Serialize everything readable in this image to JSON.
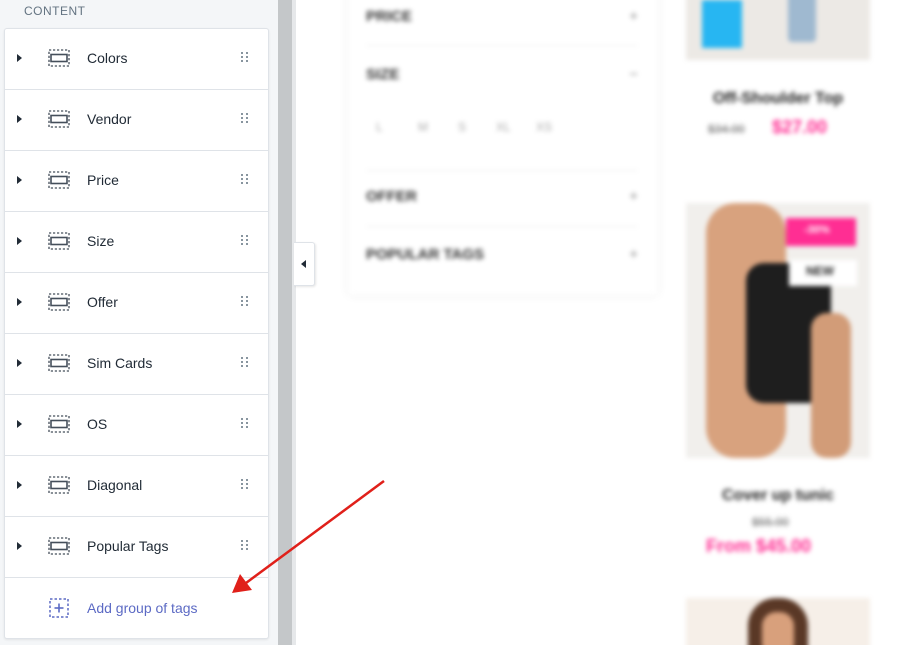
{
  "sidebar": {
    "section_title": "CONTENT",
    "items": [
      {
        "label": "Colors"
      },
      {
        "label": "Vendor"
      },
      {
        "label": "Price"
      },
      {
        "label": "Size"
      },
      {
        "label": "Offer"
      },
      {
        "label": "Sim Cards"
      },
      {
        "label": "OS"
      },
      {
        "label": "Diagonal"
      },
      {
        "label": "Popular Tags"
      }
    ],
    "add_label": "Add group of tags"
  },
  "preview": {
    "filters": [
      {
        "label": "PRICE",
        "sign": "+"
      },
      {
        "label": "SIZE",
        "sign": "−"
      },
      {
        "label": "OFFER",
        "sign": "+"
      },
      {
        "label": "POPULAR TAGS",
        "sign": "+"
      }
    ],
    "sizes": [
      "L",
      "M",
      "S",
      "XL",
      "XS"
    ],
    "products": [
      {
        "name": "Off-Shoulder Top",
        "old_price": "$34.00",
        "new_price": "$27.00"
      },
      {
        "name": "Cover up tunic",
        "old_price": "$55.00",
        "new_price": "From $45.00",
        "badge_sale": "-30%",
        "badge_new": "NEW"
      }
    ]
  },
  "colors": {
    "accent": "#5c6ac4",
    "annotation_arrow": "#e0201a",
    "price_pink": "#ff2e93"
  }
}
